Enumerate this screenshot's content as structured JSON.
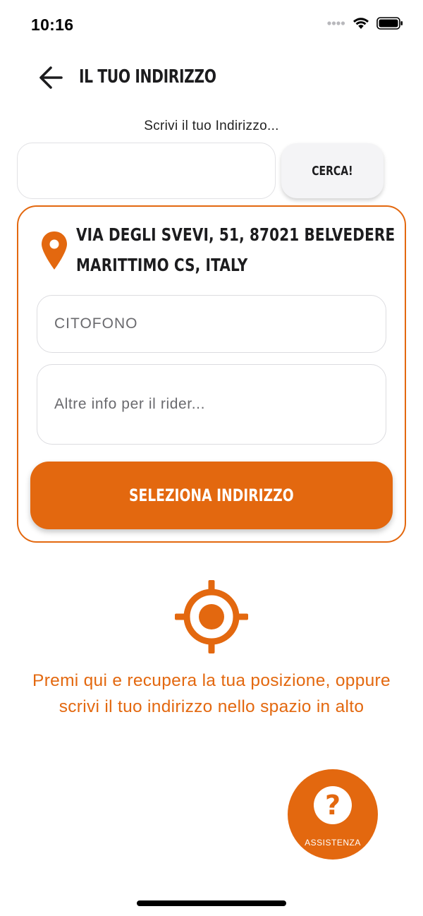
{
  "status_bar": {
    "time": "10:16"
  },
  "header": {
    "title": "IL TUO INDIRIZZO",
    "back_icon": "arrow-left-icon"
  },
  "search": {
    "caption": "Scrivi il tuo Indirizzo...",
    "input_value": "",
    "button_label": "CERCA!"
  },
  "address_card": {
    "pin_icon": "map-pin-icon",
    "address_line_1": "VIA DEGLI SVEVI, 51, 87021 BELVEDERE",
    "address_line_2": "MARITTIMO CS, ITALY",
    "intercom_placeholder": "CITOFONO",
    "notes_placeholder": "Altre info per il rider...",
    "select_label": "SELEZIONA INDIRIZZO"
  },
  "locate": {
    "icon": "crosshair-location-icon",
    "text": "Premi qui e recupera la tua posizione, oppure scrivi il tuo indirizzo nello spazio in alto"
  },
  "assist": {
    "icon": "question-mark-icon",
    "glyph": "?",
    "label": "ASSISTENZA"
  },
  "colors": {
    "accent": "#e3680f",
    "text": "#1c1c1e",
    "input_border": "#dcdce0",
    "button_light": "#f4f4f6"
  }
}
